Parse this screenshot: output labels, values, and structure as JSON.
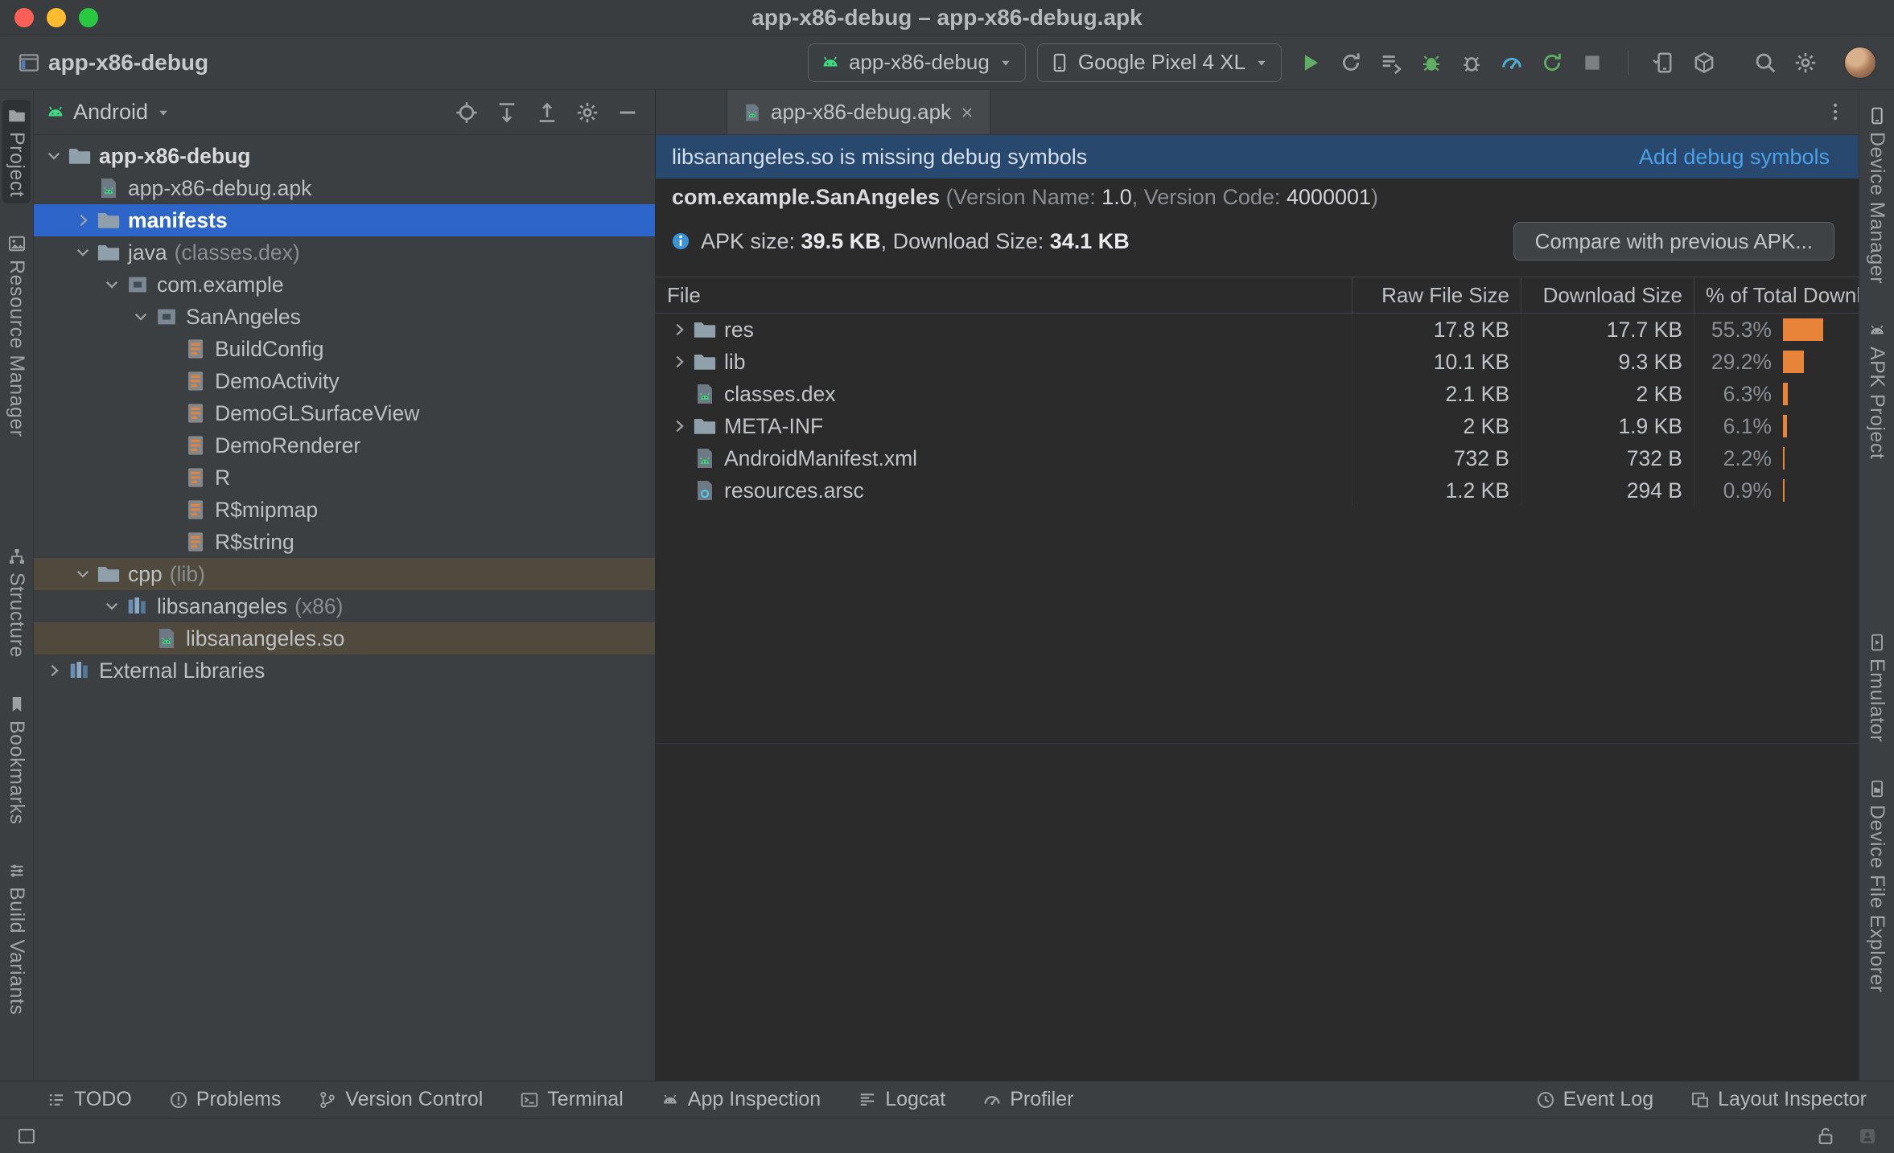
{
  "colors": {
    "selection_blue": "#2d65c8",
    "banner_blue": "#28486e",
    "link_blue": "#4ba0e8",
    "bar_orange": "#e8833a",
    "run_green": "#5fad65",
    "highlight_brown": "#4f4a3d"
  },
  "titlebar": {
    "title": "app-x86-debug – app-x86-debug.apk"
  },
  "toolbar": {
    "project_name": "app-x86-debug",
    "run_config": "app-x86-debug",
    "device": "Google Pixel 4 XL",
    "actions": [
      {
        "name": "run",
        "icon": "play"
      },
      {
        "name": "rerun",
        "icon": "rerun"
      },
      {
        "name": "apply-changes",
        "icon": "applyChanges"
      },
      {
        "name": "debug",
        "icon": "bug"
      },
      {
        "name": "attach-debugger",
        "icon": "attach"
      },
      {
        "name": "profile",
        "icon": "gauge"
      },
      {
        "name": "apply-code-changes",
        "icon": "syncGreen"
      },
      {
        "name": "stop",
        "icon": "stop"
      }
    ],
    "secondary_actions": [
      {
        "name": "device-manager",
        "icon": "phoneArrow"
      },
      {
        "name": "sync-project",
        "icon": "cube"
      }
    ],
    "right_actions": [
      {
        "name": "search-everywhere",
        "icon": "search"
      },
      {
        "name": "settings",
        "icon": "gear"
      }
    ]
  },
  "left_stripe": {
    "top": [
      {
        "label": "Project",
        "icon": "projectTw",
        "active": true
      },
      {
        "label": "Resource Manager",
        "icon": "resourceTw"
      }
    ],
    "bottom": [
      {
        "label": "Structure",
        "icon": "structureTw"
      },
      {
        "label": "Bookmarks",
        "icon": "bookmarkTw"
      },
      {
        "label": "Build Variants",
        "icon": "variantsTw"
      }
    ]
  },
  "right_stripe": {
    "top": [
      {
        "label": "Device Manager",
        "icon": "phone"
      },
      {
        "label": "APK Project",
        "icon": "androidGray"
      }
    ],
    "bottom": [
      {
        "label": "Emulator",
        "icon": "emulatorTw"
      },
      {
        "label": "Device File Explorer",
        "icon": "dfeTw"
      }
    ]
  },
  "project_panel": {
    "view": "Android",
    "header_icons": [
      {
        "name": "select-opened-file",
        "icon": "locate"
      },
      {
        "name": "expand-all",
        "icon": "expandAll"
      },
      {
        "name": "collapse-all",
        "icon": "collapseAll"
      },
      {
        "name": "settings",
        "icon": "gear"
      },
      {
        "name": "hide",
        "icon": "minus"
      }
    ],
    "tree": [
      {
        "label": "app-x86-debug",
        "level": 0,
        "chevron": "down",
        "icon": "folder",
        "bold": true
      },
      {
        "label": "app-x86-debug.apk",
        "level": 1,
        "chevron": null,
        "icon": "apk"
      },
      {
        "label": "manifests",
        "level": 1,
        "chevron": "right",
        "icon": "folder",
        "selected": true
      },
      {
        "label": "java",
        "suffix": "(classes.dex)",
        "level": 1,
        "chevron": "down",
        "icon": "folder"
      },
      {
        "label": "com.example",
        "level": 2,
        "chevron": "down",
        "icon": "package"
      },
      {
        "label": "SanAngeles",
        "level": 3,
        "chevron": "down",
        "icon": "package"
      },
      {
        "label": "BuildConfig",
        "level": 4,
        "chevron": null,
        "icon": "class"
      },
      {
        "label": "DemoActivity",
        "level": 4,
        "chevron": null,
        "icon": "class"
      },
      {
        "label": "DemoGLSurfaceView",
        "level": 4,
        "chevron": null,
        "icon": "class"
      },
      {
        "label": "DemoRenderer",
        "level": 4,
        "chevron": null,
        "icon": "class"
      },
      {
        "label": "R",
        "level": 4,
        "chevron": null,
        "icon": "class"
      },
      {
        "label": "R$mipmap",
        "level": 4,
        "chevron": null,
        "icon": "class"
      },
      {
        "label": "R$string",
        "level": 4,
        "chevron": null,
        "icon": "class"
      },
      {
        "label": "cpp",
        "suffix": "(lib)",
        "level": 1,
        "chevron": "down",
        "icon": "folder",
        "highlight": true
      },
      {
        "label": "libsanangeles",
        "suffix": "(x86)",
        "level": 2,
        "chevron": "down",
        "icon": "lib"
      },
      {
        "label": "libsanangeles.so",
        "level": 3,
        "chevron": null,
        "icon": "apk",
        "highlight": true
      },
      {
        "label": "External Libraries",
        "level": 0,
        "chevron": "right",
        "icon": "lib"
      }
    ]
  },
  "editor": {
    "tab": {
      "label": "app-x86-debug.apk"
    },
    "banner": {
      "message": "libsanangeles.so is missing debug symbols",
      "action": "Add debug symbols"
    },
    "package_info": {
      "name": "com.example.SanAngeles",
      "meta_prefix": " (Version Name: ",
      "version_name": "1.0",
      "meta_mid": ", Version Code: ",
      "version_code": "4000001",
      "meta_suffix": ")"
    },
    "apk_size": {
      "prefix": "APK size: ",
      "apk_size": "39.5 KB",
      "mid": ", Download Size: ",
      "download_size": "34.1 KB"
    },
    "compare_button": "Compare with previous APK...",
    "table": {
      "columns": [
        "File",
        "Raw File Size",
        "Download Size",
        "% of Total Downlo..."
      ],
      "rows": [
        {
          "name": "res",
          "icon": "folder",
          "expandable": true,
          "raw": "17.8 KB",
          "download": "17.7 KB",
          "pct": "55.3%",
          "pct_value": 55.3
        },
        {
          "name": "lib",
          "icon": "folder",
          "expandable": true,
          "raw": "10.1 KB",
          "download": "9.3 KB",
          "pct": "29.2%",
          "pct_value": 29.2
        },
        {
          "name": "classes.dex",
          "icon": "apk",
          "expandable": false,
          "raw": "2.1 KB",
          "download": "2 KB",
          "pct": "6.3%",
          "pct_value": 6.3
        },
        {
          "name": "META-INF",
          "icon": "folder",
          "expandable": true,
          "raw": "2 KB",
          "download": "1.9 KB",
          "pct": "6.1%",
          "pct_value": 6.1
        },
        {
          "name": "AndroidManifest.xml",
          "icon": "apk",
          "expandable": false,
          "raw": "732 B",
          "download": "732 B",
          "pct": "2.2%",
          "pct_value": 2.2
        },
        {
          "name": "resources.arsc",
          "icon": "arsc",
          "expandable": false,
          "raw": "1.2 KB",
          "download": "294 B",
          "pct": "0.9%",
          "pct_value": 0.9
        }
      ]
    }
  },
  "bottom_bar": {
    "left": [
      {
        "label": "TODO",
        "icon": "todo"
      },
      {
        "label": "Problems",
        "icon": "problems"
      },
      {
        "label": "Version Control",
        "icon": "vcs"
      },
      {
        "label": "Terminal",
        "icon": "terminal"
      },
      {
        "label": "App Inspection",
        "icon": "androidGray"
      },
      {
        "label": "Logcat",
        "icon": "logcat"
      },
      {
        "label": "Profiler",
        "icon": "profilerGray"
      }
    ],
    "right": [
      {
        "label": "Event Log",
        "icon": "eventLog"
      },
      {
        "label": "Layout Inspector",
        "icon": "layoutInspector"
      }
    ]
  },
  "status_bar": {
    "left": [
      {
        "name": "window-preview",
        "icon": "squareOutline"
      }
    ],
    "right": [
      {
        "name": "lock",
        "icon": "unlock"
      },
      {
        "name": "user-widget",
        "icon": "person"
      }
    ]
  }
}
